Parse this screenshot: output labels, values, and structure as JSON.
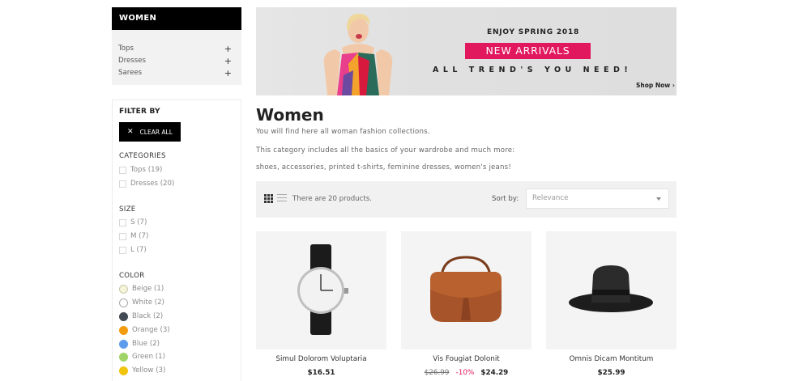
{
  "sidebar": {
    "category_title": "WOMEN",
    "categories": [
      {
        "label": "Tops"
      },
      {
        "label": "Dresses"
      },
      {
        "label": "Sarees"
      }
    ],
    "filter": {
      "title": "FILTER BY",
      "clear_label": "CLEAR ALL",
      "categories_title": "CATEGORIES",
      "category_options": [
        "Tops (19)",
        "Dresses (20)"
      ],
      "size_title": "SIZE",
      "size_options": [
        "S (7)",
        "M (7)",
        "L (7)"
      ],
      "color_title": "COLOR",
      "color_options": [
        {
          "label": "Beige (1)",
          "color": "#f5f5dc"
        },
        {
          "label": "White (2)",
          "color": "#ffffff"
        },
        {
          "label": "Black (2)",
          "color": "#434a54"
        },
        {
          "label": "Orange (3)",
          "color": "#f39c11"
        },
        {
          "label": "Blue (2)",
          "color": "#5d9cec"
        },
        {
          "label": "Green (1)",
          "color": "#a0d468"
        },
        {
          "label": "Yellow (3)",
          "color": "#f1c40f"
        }
      ]
    }
  },
  "banner": {
    "headline": "ENJOY SPRING 2018",
    "badge": "NEW ARRIVALS",
    "tagline": "ALL TREND'S YOU NEED!",
    "link": "Shop Now ›",
    "accent_color": "#e2185f"
  },
  "main": {
    "title": "Women",
    "description": [
      "You will find here all woman fashion collections.",
      "This category includes all the basics of your wardrobe and much more:",
      "shoes, accessories, printed t-shirts, feminine dresses, women's jeans!"
    ]
  },
  "toolbar": {
    "product_count": "There are 20 products.",
    "sort_label": "Sort by:",
    "sort_value": "Relevance"
  },
  "products": [
    {
      "name": "Simul Dolorom Voluptaria",
      "price": "$16.51",
      "image": "watch"
    },
    {
      "name": "Vis Fougiat Dolonit",
      "old_price": "$26.99",
      "discount": "-10%",
      "price": "$24.29",
      "image": "bag"
    },
    {
      "name": "Omnis Dicam Montitum",
      "price": "$25.99",
      "image": "hat"
    }
  ]
}
